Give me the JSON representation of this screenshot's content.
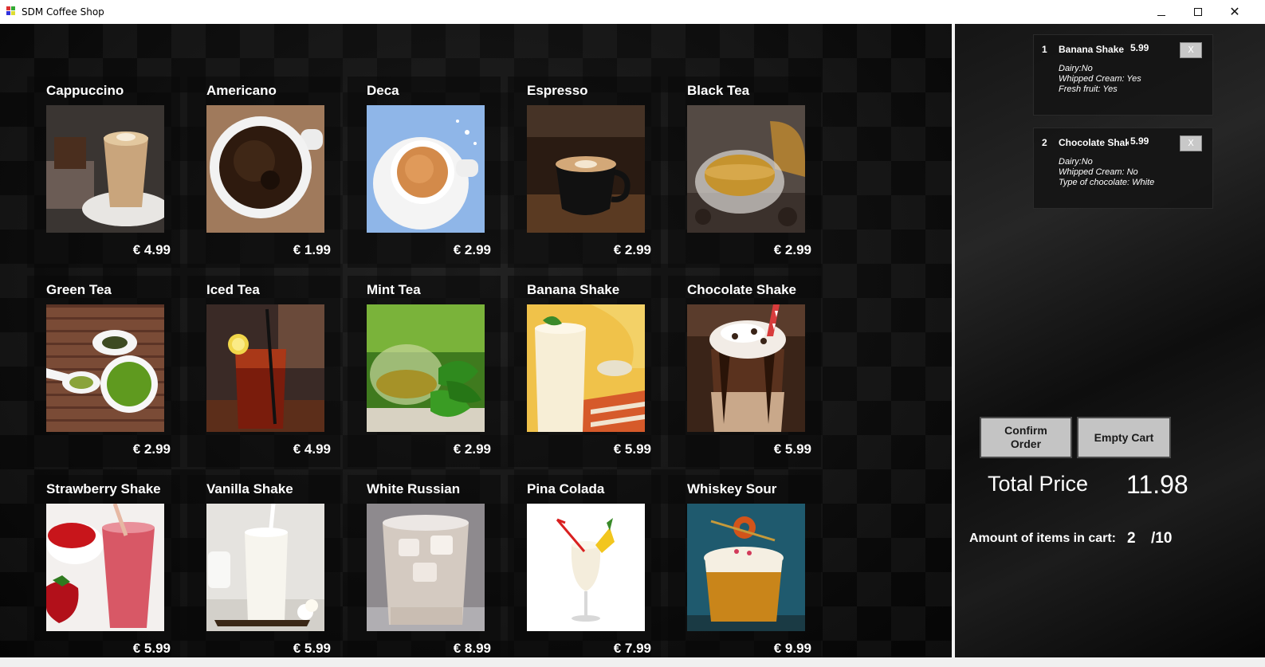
{
  "window": {
    "title": "SDM Coffee Shop",
    "minimize": "minimize",
    "maximize": "maximize",
    "close": "✕"
  },
  "menu": [
    {
      "name": "Cappuccino",
      "price": "€ 4.99",
      "image": "cappuccino-glass"
    },
    {
      "name": "Americano",
      "price": "€ 1.99",
      "image": "americano-cup"
    },
    {
      "name": "Deca",
      "price": "€ 2.99",
      "image": "deca-cup"
    },
    {
      "name": "Espresso",
      "price": "€ 2.99",
      "image": "espresso-cup"
    },
    {
      "name": "Black Tea",
      "price": "€ 2.99",
      "image": "black-tea-cup"
    },
    {
      "name": "Green Tea",
      "price": "€ 2.99",
      "image": "green-tea-bowl"
    },
    {
      "name": "Iced Tea",
      "price": "€ 4.99",
      "image": "iced-tea-glass"
    },
    {
      "name": "Mint Tea",
      "price": "€ 2.99",
      "image": "mint-tea-glass"
    },
    {
      "name": "Banana Shake",
      "price": "€ 5.99",
      "image": "banana-shake-glass"
    },
    {
      "name": "Chocolate Shake",
      "price": "€ 5.99",
      "image": "chocolate-shake-jar"
    },
    {
      "name": "Strawberry Shake",
      "price": "€ 5.99",
      "image": "strawberry-shake-glass"
    },
    {
      "name": "Vanilla Shake",
      "price": "€ 5.99",
      "image": "vanilla-shake-glass"
    },
    {
      "name": "White Russian",
      "price": "€ 8.99",
      "image": "white-russian-glass"
    },
    {
      "name": "Pina Colada",
      "price": "€ 7.99",
      "image": "pina-colada-glass"
    },
    {
      "name": "Whiskey Sour",
      "price": "€ 9.99",
      "image": "whiskey-sour-glass"
    }
  ],
  "cart": {
    "items": [
      {
        "num": "1",
        "name": "Banana Shake",
        "price": "5.99",
        "remove": "X",
        "options": [
          "Dairy:No",
          "Whipped Cream: Yes",
          "Fresh fruit: Yes"
        ]
      },
      {
        "num": "2",
        "name": "Chocolate Shake",
        "price": "5.99",
        "remove": "X",
        "options": [
          "Dairy:No",
          "Whipped Cream: No",
          "Type of chocolate: White"
        ]
      }
    ],
    "confirm_line1": "Confirm",
    "confirm_line2": "Order",
    "empty_label": "Empty Cart",
    "total_label": "Total Price",
    "total_value": "11.98",
    "amount_label": "Amount of items in cart:",
    "amount_count": "2",
    "amount_max": "/10"
  },
  "colors": {
    "panel_bg": "#0b0b0b",
    "text": "#ffffff",
    "button_bg": "#c4c4c4",
    "divider": "#f2f2f2"
  }
}
